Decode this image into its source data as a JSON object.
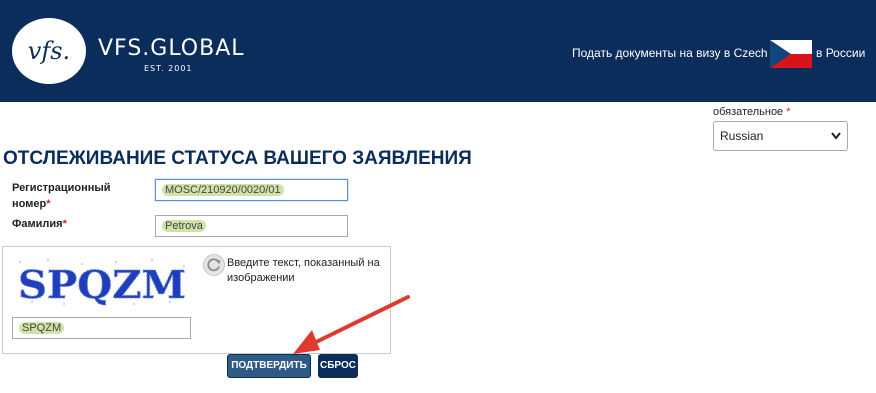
{
  "header": {
    "logo_mark": "vfs.",
    "brand_name": "VFS.GLOBAL",
    "brand_est": "EST. 2001",
    "text_before_flag": "Подать документы на визу в Czech",
    "text_after_flag": "в России",
    "flag_icon": "czech-flag-icon",
    "colors": {
      "header_bg": "#0b2d5b",
      "flag_white": "#ffffff",
      "flag_red": "#d7141a",
      "flag_blue": "#11457e"
    }
  },
  "language": {
    "label": "обязательное",
    "required_mark": "*",
    "selected": "Russian"
  },
  "page_title": "ОТСЛЕЖИВАНИЕ СТАТУСА ВАШЕГО ЗАЯВЛЕНИЯ",
  "form": {
    "reg_number": {
      "label": "Регистрационный номер",
      "required_mark": "*",
      "value": "MOSC/210920/0020/01"
    },
    "surname": {
      "label": "Фамилия",
      "required_mark": "*",
      "value": "Petrova"
    },
    "captcha": {
      "image_text": "SPQZM",
      "refresh_icon": "refresh-icon",
      "help_text": "Введите текст, показанный на изображении",
      "input_value": "SPQZM"
    }
  },
  "buttons": {
    "submit": "ПОДТВЕРДИТЬ",
    "reset": "СБРОС"
  },
  "annotation": {
    "arrow_icon": "red-arrow-icon",
    "color": "#e03a2e"
  }
}
